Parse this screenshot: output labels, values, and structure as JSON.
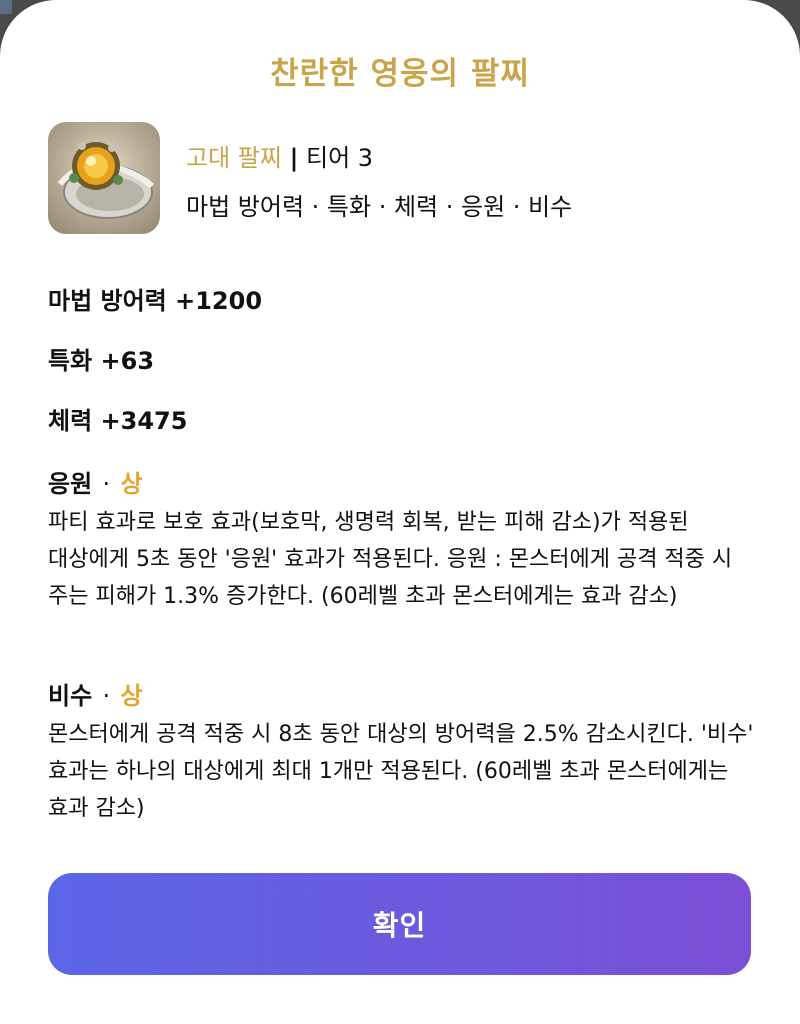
{
  "dialog": {
    "title": "찬란한 영웅의 팔찌",
    "confirm_label": "확인"
  },
  "item": {
    "icon": "bracelet-icon",
    "grade": "고대 팔찌",
    "separator": "|",
    "tier": "티어 3",
    "effect_summary": "마법 방어력 · 특화 · 체력 · 응원 · 비수"
  },
  "stats": [
    {
      "text": "마법 방어력 +1200"
    },
    {
      "text": "특화 +63"
    },
    {
      "text": "체력 +3475"
    }
  ],
  "engravings": [
    {
      "name": "응원",
      "dot": "·",
      "level": "상",
      "description": "파티 효과로 보호 효과(보호막, 생명력 회복, 받는 피해 감소)가 적용된 대상에게 5초 동안 '응원' 효과가 적용된다. 응원 : 몬스터에게 공격 적중 시 주는 피해가 1.3% 증가한다. (60레벨 초과 몬스터에게는 효과 감소)"
    },
    {
      "name": "비수",
      "dot": "·",
      "level": "상",
      "description": "몬스터에게 공격 적중 시 8초 동안 대상의 방어력을 2.5% 감소시킨다. '비수' 효과는 하나의 대상에게 최대 1개만 적용된다. (60레벨 초과 몬스터에게는 효과 감소)"
    }
  ],
  "colors": {
    "title_gold": "#c9a44b",
    "level_orange": "#e6a52e",
    "button_start": "#5b66e6",
    "button_end": "#7a4fd6"
  }
}
